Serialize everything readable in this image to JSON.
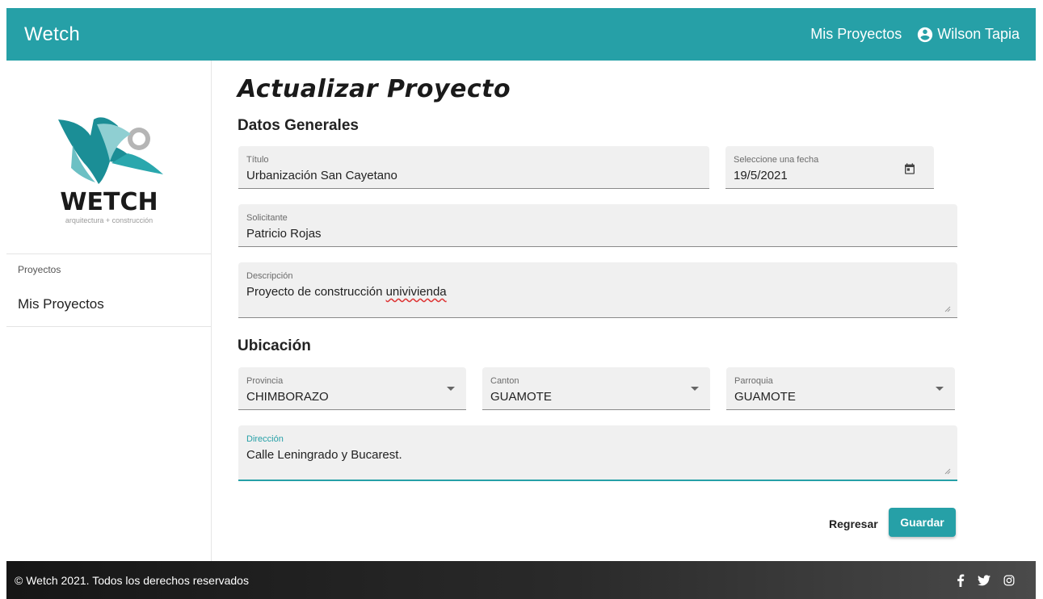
{
  "header": {
    "brand": "Wetch",
    "nav_projects": "Mis Proyectos",
    "user_name": "Wilson Tapia"
  },
  "sidebar": {
    "logo_text": "WETCH",
    "logo_tagline": "arquitectura + construcción",
    "section_label": "Proyectos",
    "items": [
      {
        "label": "Mis Proyectos"
      }
    ]
  },
  "page": {
    "title": "Actualizar Proyecto",
    "section_general": "Datos Generales",
    "section_location": "Ubicación"
  },
  "form": {
    "titulo": {
      "label": "Título",
      "value": "Urbanización San Cayetano"
    },
    "fecha": {
      "label": "Seleccione una fecha",
      "value": "19/5/2021"
    },
    "solicitante": {
      "label": "Solicitante",
      "value": "Patricio Rojas"
    },
    "descripcion": {
      "label": "Descripción",
      "value_prefix": "Proyecto de construcción ",
      "value_misspelled": "univivienda"
    },
    "provincia": {
      "label": "Provincia",
      "value": "CHIMBORAZO"
    },
    "canton": {
      "label": "Canton",
      "value": "GUAMOTE"
    },
    "parroquia": {
      "label": "Parroquia",
      "value": "GUAMOTE"
    },
    "direccion": {
      "label": "Dirección",
      "value": "Calle Leningrado y Bucarest."
    }
  },
  "actions": {
    "back_label": "Regresar",
    "save_label": "Guardar"
  },
  "footer": {
    "copyright": "© Wetch 2021. Todos los derechos reservados"
  },
  "icons": {
    "user": "account-circle-icon",
    "calendar": "calendar-icon",
    "dropdown": "arrow-drop-down-icon",
    "facebook": "facebook-icon",
    "twitter": "twitter-icon",
    "instagram": "instagram-icon"
  },
  "colors": {
    "primary": "#26a0a7",
    "field_bg": "#f0f0f0",
    "footer_dark": "#161616"
  }
}
